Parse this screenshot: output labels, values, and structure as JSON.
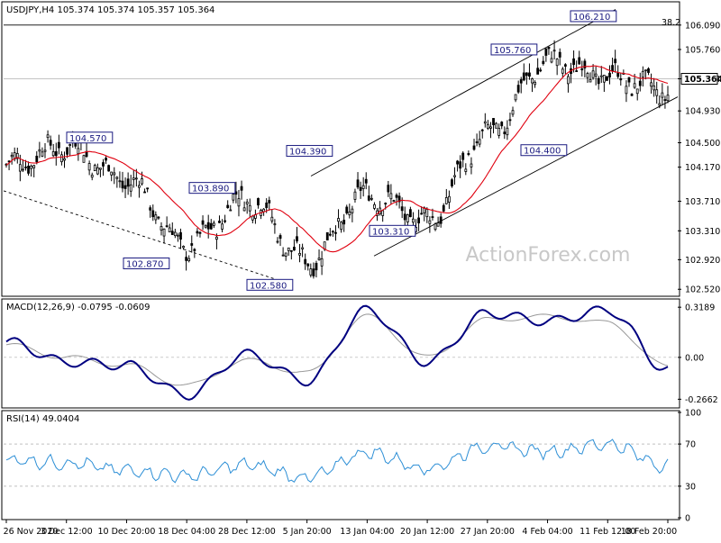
{
  "colors": {
    "background": "#ffffff",
    "candle": "#000000",
    "moving_average": "#e0000f",
    "macd_main": "#000080",
    "macd_signal": "#999999",
    "rsi": "#2d8fd6",
    "channel": "#000000",
    "callout": "#1a1a80",
    "watermark": "#c8c8c8"
  },
  "watermark": "ActionForex.com",
  "chart_data": [
    {
      "type": "line",
      "panel": "price",
      "header": "USDJPY,H4  105.374 105.374 105.357 105.364",
      "ylim": [
        102.45,
        106.38
      ],
      "y_ticks": [
        "106.090",
        "105.760",
        "105.364",
        "104.930",
        "104.500",
        "104.170",
        "103.710",
        "103.310",
        "102.920",
        "102.520"
      ],
      "y_tick_values": [
        106.09,
        105.76,
        105.364,
        104.93,
        104.5,
        104.17,
        103.71,
        103.31,
        102.92,
        102.52
      ],
      "x_ticks": [
        "26 Nov 2020",
        "3 Dec 12:00",
        "10 Dec 20:00",
        "18 Dec 04:00",
        "28 Dec 12:00",
        "5 Jan 20:00",
        "13 Jan 04:00",
        "20 Jan 12:00",
        "27 Jan 20:00",
        "4 Feb 04:00",
        "11 Feb 12:00",
        "18 Feb 20:00"
      ],
      "last_price": "105.364",
      "fib_label": "38.2",
      "series": [
        {
          "name": "USDJPY,H4",
          "x": [
            "26 Nov 2020",
            "3 Dec 12:00",
            "10 Dec 20:00",
            "18 Dec 04:00",
            "28 Dec 12:00",
            "5 Jan 20:00",
            "13 Jan 04:00",
            "20 Jan 12:00",
            "27 Jan 20:00",
            "4 Feb 04:00",
            "11 Feb 12:00",
            "18 Feb 20:00"
          ],
          "values": [
            104.2,
            104.45,
            104.0,
            103.1,
            103.75,
            102.9,
            103.8,
            103.45,
            104.6,
            105.6,
            105.4,
            105.2
          ]
        }
      ],
      "annotations": [
        {
          "label": "104.570",
          "value": 104.57
        },
        {
          "label": "103.890",
          "value": 103.89
        },
        {
          "label": "102.870",
          "value": 102.87
        },
        {
          "label": "102.580",
          "value": 102.58
        },
        {
          "label": "104.390",
          "value": 104.39
        },
        {
          "label": "103.310",
          "value": 103.31
        },
        {
          "label": "105.760",
          "value": 105.76
        },
        {
          "label": "104.400",
          "value": 104.4
        },
        {
          "label": "106.210",
          "value": 106.21
        }
      ]
    },
    {
      "type": "line",
      "panel": "macd",
      "header": "MACD(12,26,9) -0.0795 -0.0609",
      "ylim": [
        -0.31,
        0.36
      ],
      "y_ticks": [
        "0.3189",
        "0.00",
        "-0.2662"
      ],
      "y_tick_values": [
        0.3189,
        0.0,
        -0.2662
      ],
      "series": [
        {
          "name": "MACD",
          "x": [
            "26 Nov 2020",
            "3 Dec 12:00",
            "10 Dec 20:00",
            "18 Dec 04:00",
            "28 Dec 12:00",
            "5 Jan 20:00",
            "13 Jan 04:00",
            "20 Jan 12:00",
            "27 Jan 20:00",
            "4 Feb 04:00",
            "11 Feb 12:00",
            "18 Feb 20:00"
          ],
          "values": [
            0.1,
            -0.03,
            -0.05,
            -0.24,
            0.02,
            -0.15,
            0.3,
            -0.03,
            0.28,
            0.23,
            0.3,
            -0.0795
          ]
        },
        {
          "name": "Signal",
          "x": [
            "26 Nov 2020",
            "3 Dec 12:00",
            "10 Dec 20:00",
            "18 Dec 04:00",
            "28 Dec 12:00",
            "5 Jan 20:00",
            "13 Jan 04:00",
            "20 Jan 12:00",
            "27 Jan 20:00",
            "4 Feb 04:00",
            "11 Feb 12:00",
            "18 Feb 20:00"
          ],
          "values": [
            0.08,
            0.0,
            -0.05,
            -0.18,
            -0.02,
            -0.1,
            0.26,
            0.0,
            0.24,
            0.26,
            0.22,
            -0.0609
          ]
        }
      ]
    },
    {
      "type": "line",
      "panel": "rsi",
      "header": "RSI(14) 49.0404",
      "ylim": [
        0,
        100
      ],
      "y_ticks": [
        "100",
        "70",
        "30",
        "0"
      ],
      "y_tick_values": [
        100,
        70,
        30,
        0
      ],
      "series": [
        {
          "name": "RSI(14)",
          "x": [
            "26 Nov 2020",
            "3 Dec 12:00",
            "10 Dec 20:00",
            "18 Dec 04:00",
            "28 Dec 12:00",
            "5 Jan 20:00",
            "13 Jan 04:00",
            "20 Jan 12:00",
            "27 Jan 20:00",
            "4 Feb 04:00",
            "11 Feb 12:00",
            "18 Feb 20:00"
          ],
          "values": [
            55,
            52,
            45,
            40,
            50,
            38,
            62,
            47,
            68,
            63,
            70,
            49.04
          ]
        }
      ]
    }
  ]
}
